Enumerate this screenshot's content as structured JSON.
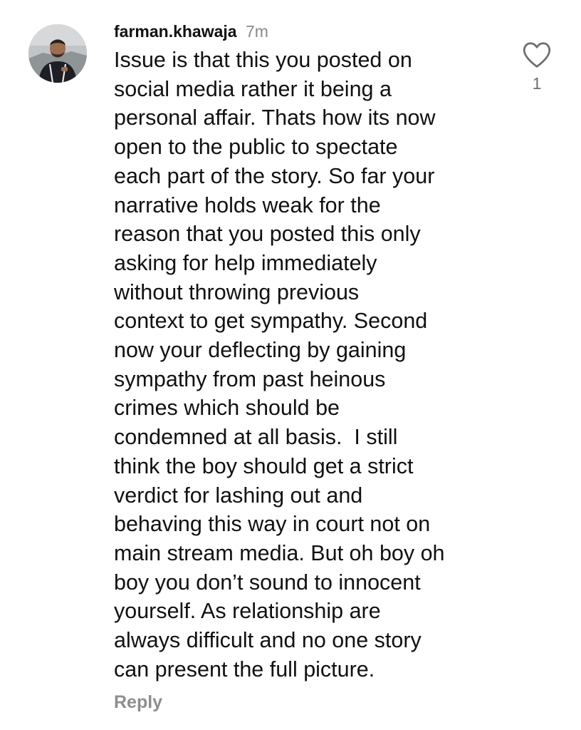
{
  "comment": {
    "username": "farman.khawaja",
    "time": "7m",
    "text_lines": [
      "Issue is that this you posted on",
      "social media rather it being a",
      "personal affair. Thats how its now",
      "open to the public to spectate",
      "each part of the story. So far your",
      "narrative holds weak for the",
      "reason that you posted this only",
      "asking for help immediately",
      "without throwing previous",
      "context to get sympathy. Second",
      "now your deflecting by gaining",
      "sympathy from past heinous",
      "crimes which should be",
      "condemned at all basis.  I still",
      "think the boy should get a strict",
      "verdict for lashing out and",
      "behaving this way in court not on",
      "main stream media. But oh boy oh",
      "boy you don’t sound to innocent",
      "yourself. As relationship are",
      "always difficult and no one story",
      "can present the full picture."
    ],
    "reply_label": "Reply",
    "like_count": "1",
    "like_icon": "heart-outline-icon",
    "avatar": "profile-photo"
  },
  "colors": {
    "text": "#111111",
    "secondary": "#8e8e8e",
    "background": "#ffffff"
  }
}
